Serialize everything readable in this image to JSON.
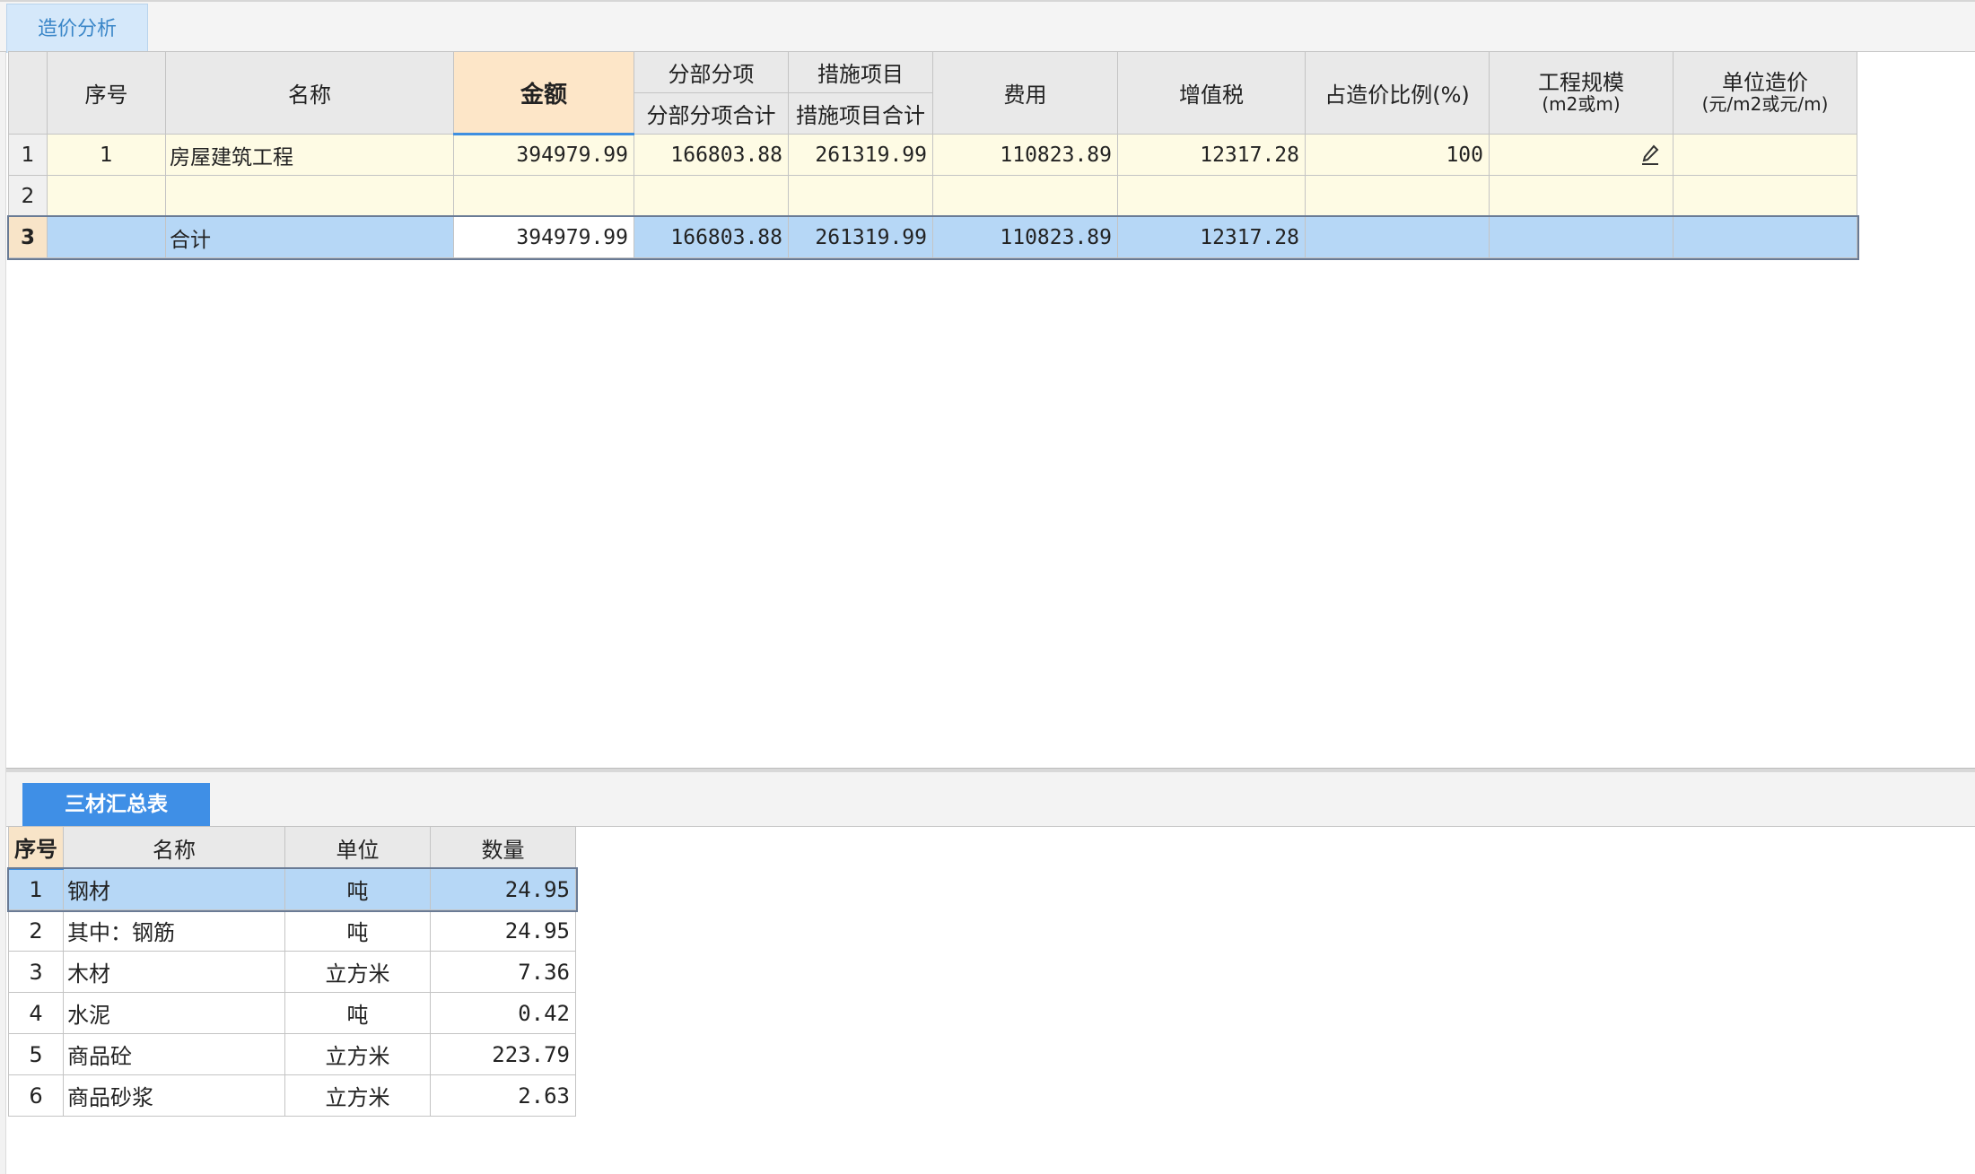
{
  "top_tab": {
    "label": "造价分析"
  },
  "upper": {
    "headers": {
      "seq": "序号",
      "name": "名称",
      "amount": "金额",
      "fbfx_group": "分部分项",
      "fbfx_sub": "分部分项合计",
      "csxm_group": "措施项目",
      "csxm_sub": "措施项目合计",
      "fee": "费用",
      "vat": "增值税",
      "ratio": "占造价比例(%)",
      "scale": "工程规模",
      "scale_unit": "(m2或m)",
      "unit_cost": "单位造价",
      "unit_cost_unit": "(元/m2或元/m)"
    },
    "rows": [
      {
        "rownum": "1",
        "seq": "1",
        "name": "房屋建筑工程",
        "amount": "394979.99",
        "fbfx": "166803.88",
        "csxm": "261319.99",
        "fee": "110823.89",
        "vat": "12317.28",
        "ratio": "100",
        "scale": "",
        "unit_cost": ""
      },
      {
        "rownum": "2",
        "seq": "",
        "name": "",
        "amount": "",
        "fbfx": "",
        "csxm": "",
        "fee": "",
        "vat": "",
        "ratio": "",
        "scale": "",
        "unit_cost": ""
      },
      {
        "rownum": "3",
        "seq": "",
        "name": "合计",
        "amount": "394979.99",
        "fbfx": "166803.88",
        "csxm": "261319.99",
        "fee": "110823.89",
        "vat": "12317.28",
        "ratio": "",
        "scale": "",
        "unit_cost": ""
      }
    ]
  },
  "lower_tab": {
    "label": "三材汇总表"
  },
  "lower": {
    "headers": {
      "seq": "序号",
      "name": "名称",
      "unit": "单位",
      "qty": "数量"
    },
    "rows": [
      {
        "seq": "1",
        "name": "钢材",
        "unit": "吨",
        "qty": "24.95"
      },
      {
        "seq": "2",
        "name": "其中：钢筋",
        "unit": "吨",
        "qty": "24.95"
      },
      {
        "seq": "3",
        "name": "木材",
        "unit": "立方米",
        "qty": "7.36"
      },
      {
        "seq": "4",
        "name": "水泥",
        "unit": "吨",
        "qty": "0.42"
      },
      {
        "seq": "5",
        "name": "商品砼",
        "unit": "立方米",
        "qty": "223.79"
      },
      {
        "seq": "6",
        "name": "商品砂浆",
        "unit": "立方米",
        "qty": "2.63"
      }
    ]
  },
  "icons": {
    "edit": "pencil-icon"
  }
}
